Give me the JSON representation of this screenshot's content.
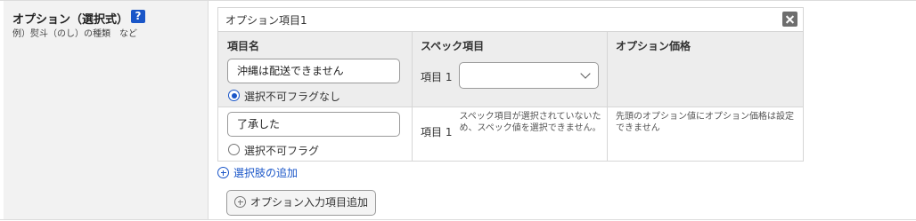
{
  "field": {
    "title": "オプション（選択式）",
    "help_label": "?",
    "note": "例）熨斗（のし）の種類　など"
  },
  "panel": {
    "title": "オプション項目1",
    "close_icon": "close-icon",
    "columns": [
      "項目名",
      "スペック項目",
      "オプション価格"
    ],
    "rows": [
      {
        "name_value": "沖縄は配送できません",
        "radio_label": "選択不可フラグなし",
        "radio_checked": true,
        "spec_label": "項目 1",
        "spec_select_value": "",
        "price_note": ""
      },
      {
        "name_value": "了承した",
        "radio_label": "選択不可フラグ",
        "radio_checked": false,
        "spec_label": "項目 1",
        "spec_note": "スペック項目が選択されていないため、スペック値を選択できません。",
        "price_note": "先頭のオプション値にオプション価格は設定できません"
      }
    ],
    "add_choice_label": "選択肢の追加"
  },
  "add_option_button_label": "オプション入力項目追加",
  "colors": {
    "accent": "#1a56c8",
    "label_bg": "#f2f2f2",
    "header_bg": "#ededed",
    "border": "#d6d6d6"
  }
}
